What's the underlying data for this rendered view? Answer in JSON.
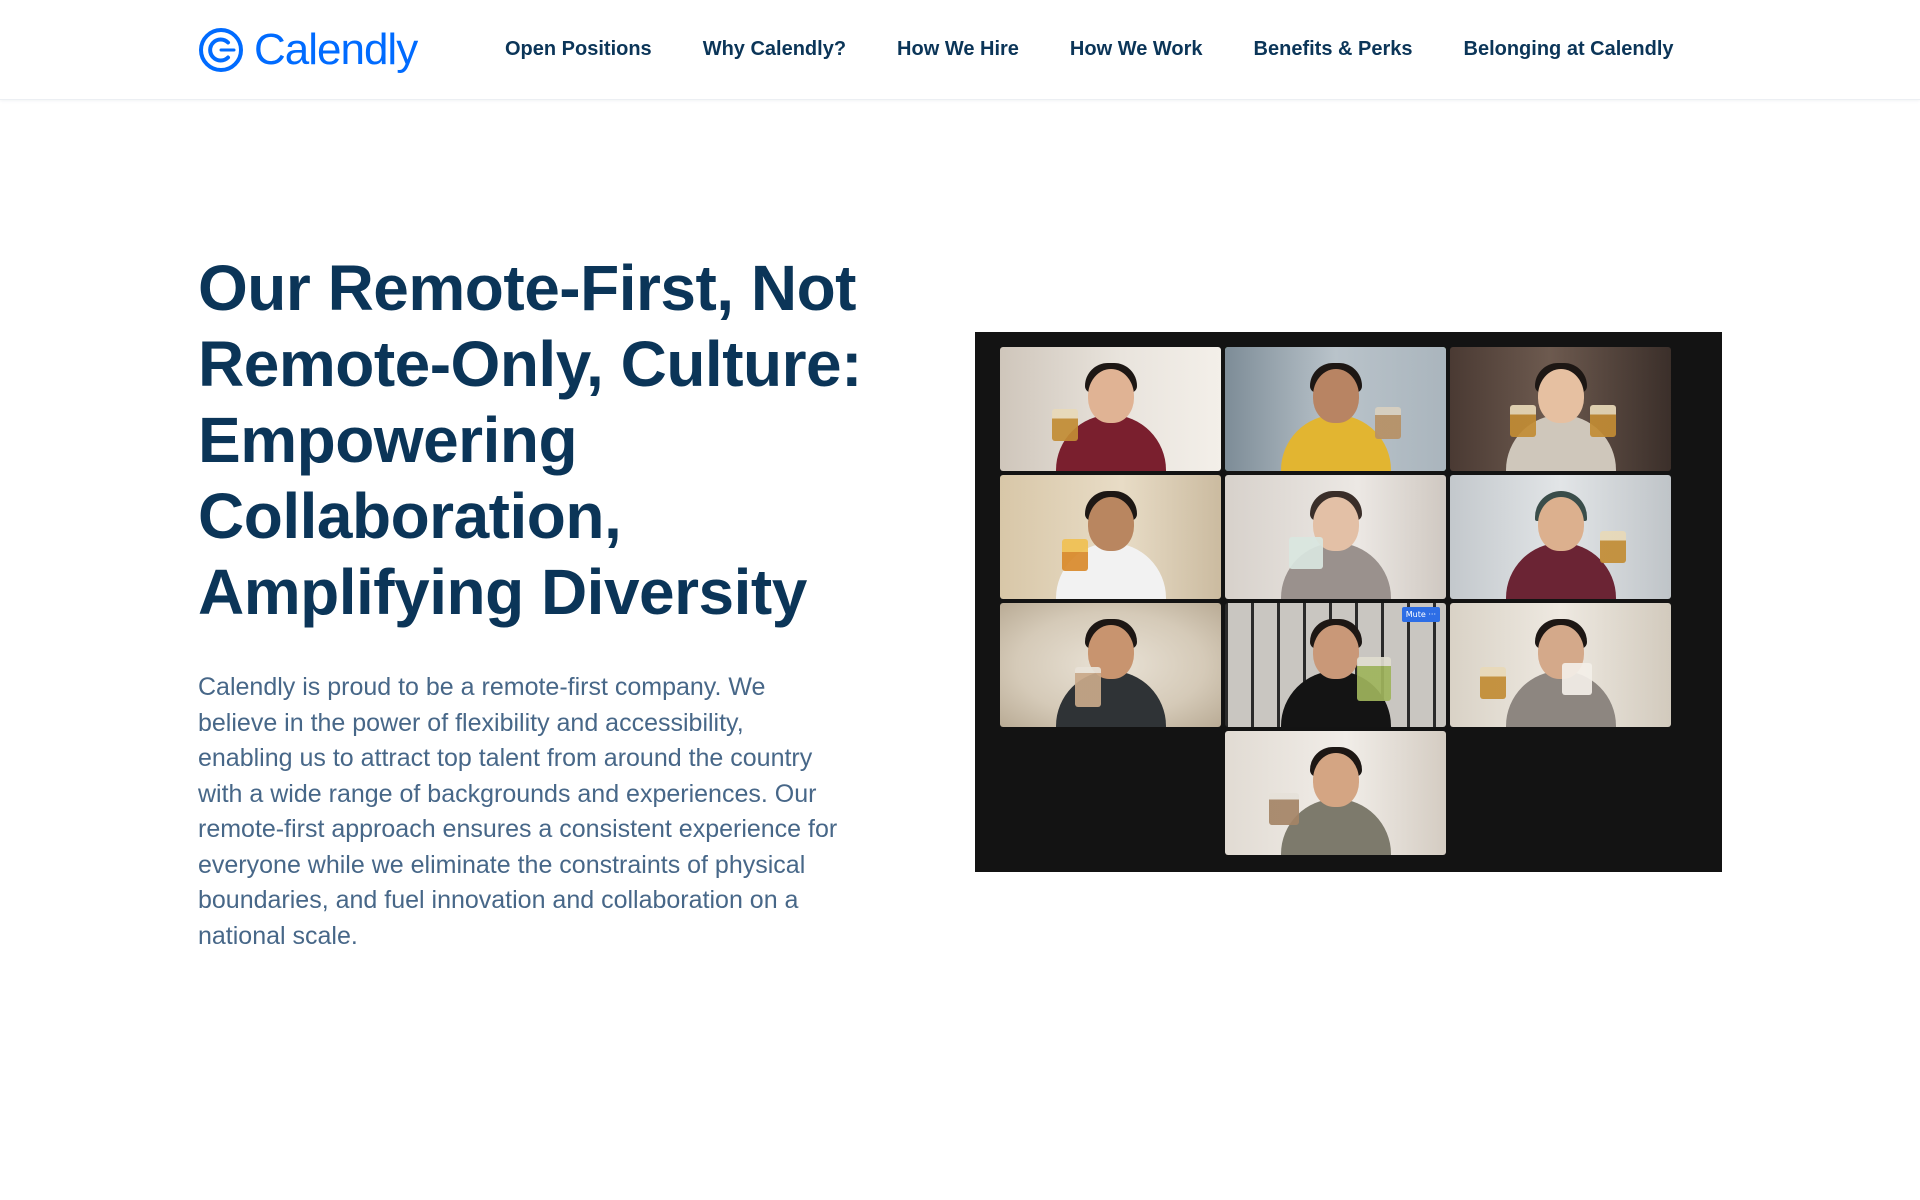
{
  "header": {
    "logo": {
      "text": "Calendly",
      "icon": "calendly-logo-icon",
      "color": "#006bff"
    },
    "nav": [
      {
        "label": "Open Positions"
      },
      {
        "label": "Why Calendly?"
      },
      {
        "label": "How We Hire"
      },
      {
        "label": "How We Work"
      },
      {
        "label": "Benefits & Perks"
      },
      {
        "label": "Belonging at Calendly"
      }
    ]
  },
  "hero": {
    "title": "Our Remote-First, Not Remote-Only, Culture: Empowering Collaboration, Amplifying Diversity",
    "body": "Calendly is proud to be a remote-first company. We believe in the power of flexibility and accessibility, enabling us to attract top talent from around the country with a wide range of backgrounds and experiences. Our remote-first approach ensures a consistent experience for everyone while we eliminate the constraints of physical boundaries, and fuel innovation and collaboration on a national scale."
  },
  "video_call": {
    "mute_label": "Mute",
    "more_label": "···"
  },
  "colors": {
    "heading": "#0b3558",
    "body_text": "#476788",
    "brand": "#006bff",
    "call_background": "#131313",
    "active_speaker": "#6cc36c",
    "mute_chip": "#2d6ee6"
  }
}
